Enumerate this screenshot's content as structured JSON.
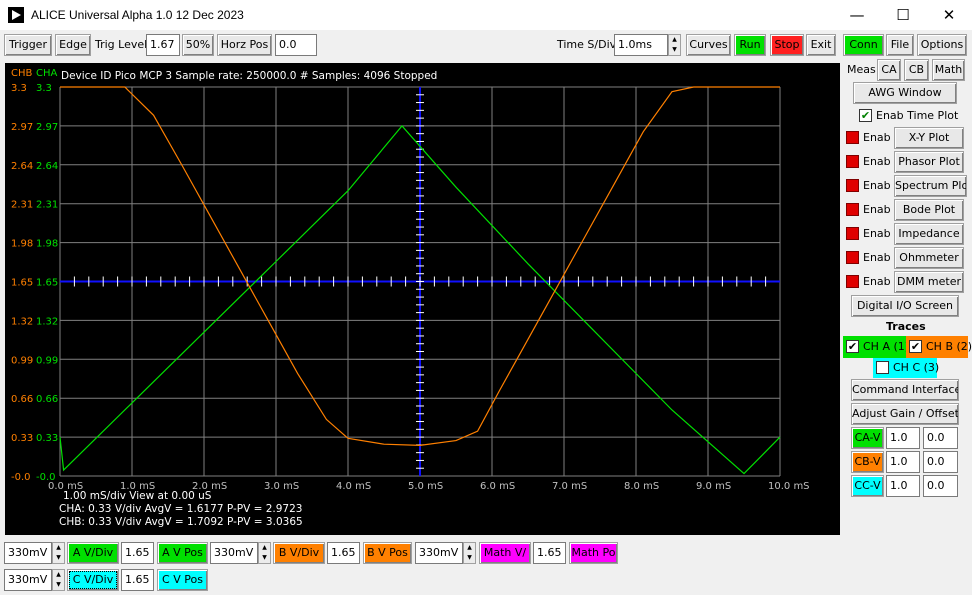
{
  "window": {
    "title": "ALICE Universal Alpha 1.0 12 Dec 2023",
    "minimize": "—",
    "maximize": "☐",
    "close": "✕"
  },
  "toolbar": {
    "trigger": "Trigger",
    "edge": "Edge",
    "trig_level_label": "Trig Level",
    "trig_level_value": "1.67",
    "pct50": "50%",
    "horz_pos_label": "Horz Pos",
    "horz_pos_value": "0.0",
    "time_div_label": "Time S/Div",
    "time_div_value": "1.0ms",
    "curves": "Curves",
    "run": "Run",
    "stop": "Stop",
    "exit": "Exit"
  },
  "colors": {
    "cha": "#00e000",
    "chb": "#ff8000",
    "chc": "#00ffff",
    "math": "#ff00ff",
    "grid": "#808080",
    "cursor": "#1010ff"
  },
  "scope": {
    "chb_label": "CHB",
    "cha_label": "CHA",
    "header": "Device ID Pico MCP 3 Sample rate:  250000.0  # Samples: 4096 Stopped",
    "y_ticks_b": [
      "3.3",
      "2.97",
      "2.64",
      "2.31",
      "1.98",
      "1.65",
      "1.32",
      "0.99",
      "0.66",
      "0.33",
      "-0.0"
    ],
    "y_ticks_a": [
      "3.3",
      "2.97",
      "2.64",
      "2.31",
      "1.98",
      "1.65",
      "1.32",
      "0.99",
      "0.66",
      "0.33",
      "-0.0"
    ],
    "x_ticks": [
      "0.0  mS",
      "1.0  mS",
      "2.0  mS",
      "3.0  mS",
      "4.0  mS",
      "5.0  mS",
      "6.0  mS",
      "7.0  mS",
      "8.0  mS",
      "9.0  mS",
      "10.0  mS"
    ],
    "info1": "1.00  mS/div  View at  0.00  uS",
    "info2": "CHA: 0.33 V/div AvgV =  1.6177  P-PV =  2.9723",
    "info3": "CHB: 0.33 V/div AvgV =  1.7092  P-PV =  3.0365"
  },
  "chart_data": {
    "type": "line",
    "x_unit": "mS",
    "xlim": [
      0,
      10
    ],
    "ylim": [
      0,
      3.3
    ],
    "series": [
      {
        "name": "CHA",
        "color": "#00e000",
        "x": [
          0.0,
          0.05,
          1.0,
          2.0,
          3.0,
          4.0,
          4.75,
          5.5,
          6.5,
          7.5,
          8.5,
          9.5,
          10.0
        ],
        "y": [
          0.33,
          0.05,
          0.62,
          1.22,
          1.82,
          2.42,
          2.97,
          2.45,
          1.8,
          1.18,
          0.56,
          0.02,
          0.33
        ]
      },
      {
        "name": "CHB",
        "color": "#ff8000",
        "x": [
          0.0,
          0.9,
          1.3,
          1.7,
          2.1,
          2.5,
          2.9,
          3.3,
          3.7,
          4.0,
          4.5,
          5.0,
          5.5,
          5.8,
          6.1,
          6.5,
          6.9,
          7.3,
          7.7,
          8.1,
          8.5,
          8.8,
          9.2,
          10.0
        ],
        "y": [
          3.3,
          3.3,
          3.06,
          2.63,
          2.19,
          1.75,
          1.31,
          0.87,
          0.48,
          0.32,
          0.27,
          0.26,
          0.3,
          0.38,
          0.72,
          1.16,
          1.6,
          2.04,
          2.48,
          2.92,
          3.26,
          3.3,
          3.3,
          3.3
        ]
      }
    ]
  },
  "side": {
    "conn": "Conn",
    "file": "File",
    "options": "Options",
    "meas": "Meas",
    "ca": "CA",
    "cb": "CB",
    "math": "Math",
    "awg": "AWG Window",
    "enab_time_plot": "Enab Time Plot",
    "enab": "Enab",
    "xy": "X-Y Plot",
    "phasor": "Phasor Plot",
    "spectrum": "Spectrum Plo",
    "bode": "Bode Plot",
    "impedance": "Impedance",
    "ohmmeter": "Ohmmeter",
    "dmm": "DMM meter",
    "digital": "Digital I/O Screen",
    "traces": "Traces",
    "cha_trace": "CH A (1)",
    "chb_trace": "CH B (2)",
    "chc_trace": "CH C (3)",
    "cmd": "Command Interface",
    "adjust": "Adjust Gain / Offset",
    "cav": "CA-V",
    "cbv": "CB-V",
    "ccv": "CC-V",
    "cav_gain": "1.0",
    "cav_off": "0.0",
    "cbv_gain": "1.0",
    "cbv_off": "0.0",
    "ccv_gain": "1.0",
    "ccv_off": "0.0"
  },
  "bottom": {
    "a_vdiv_val": "330mV",
    "a_vdiv": "A V/Div",
    "a_pos_val": "1.65",
    "a_pos": "A V Pos",
    "b_vdiv_val": "330mV",
    "b_vdiv": "B V/Div",
    "b_pos_val": "1.65",
    "b_pos": "B V Pos",
    "m_vdiv_val": "330mV",
    "m_vdiv": "Math V/",
    "m_pos_val": "1.65",
    "m_pos": "Math Po",
    "c_vdiv_val": "330mV",
    "c_vdiv": "C V/Div",
    "c_pos_val": "1.65",
    "c_pos": "C V Pos"
  }
}
